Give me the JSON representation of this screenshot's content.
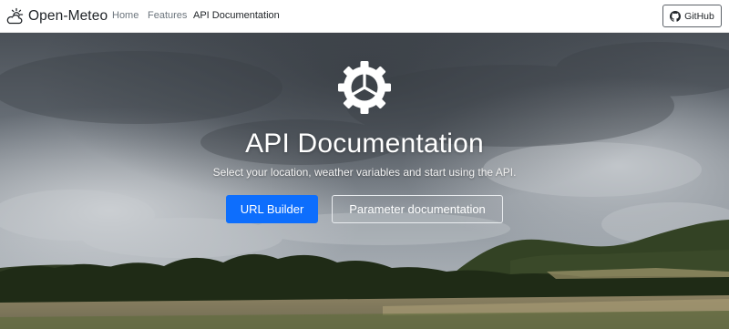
{
  "navbar": {
    "brand": {
      "text": "Open-Meteo",
      "icon": "cloud-sun-icon"
    },
    "links": [
      {
        "label": "Home",
        "active": false
      },
      {
        "label": "Features",
        "active": false
      },
      {
        "label": "API Documentation",
        "active": true
      }
    ],
    "github_button": {
      "label": "GitHub",
      "icon": "github-icon"
    }
  },
  "hero": {
    "icon": "gear-icon",
    "title": "API Documentation",
    "subtitle": "Select your location, weather variables and start using the API.",
    "buttons": [
      {
        "label": "URL Builder",
        "style": "primary"
      },
      {
        "label": "Parameter documentation",
        "style": "outline-light"
      }
    ]
  },
  "colors": {
    "primary": "#0d6efd",
    "nav_text": "#6c757d",
    "nav_active": "#212529"
  }
}
